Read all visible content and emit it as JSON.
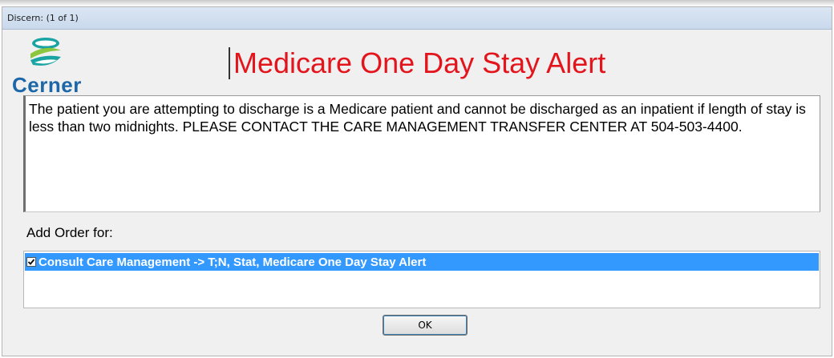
{
  "window": {
    "title": "Discern:  (1 of 1)"
  },
  "logo": {
    "text": "Cerner",
    "icon": "cerner-logo-icon",
    "colors": {
      "green": "#8cc63f",
      "teal": "#1aa3a3",
      "blue": "#1c67a7"
    }
  },
  "alert": {
    "title": "Medicare One Day Stay Alert",
    "title_color": "#e3141b",
    "message": "The patient you are attempting to discharge is a Medicare patient and cannot be discharged as an inpatient if length of stay is less than two midnights. PLEASE CONTACT THE CARE MANAGEMENT TRANSFER CENTER AT 504-503-4400."
  },
  "orders": {
    "label": "Add Order for:",
    "items": [
      {
        "checked": true,
        "label": "Consult Care Management -> T;N, Stat, Medicare One Day Stay Alert",
        "selected_color": "#3399ff"
      }
    ]
  },
  "buttons": {
    "ok_label": "OK"
  }
}
